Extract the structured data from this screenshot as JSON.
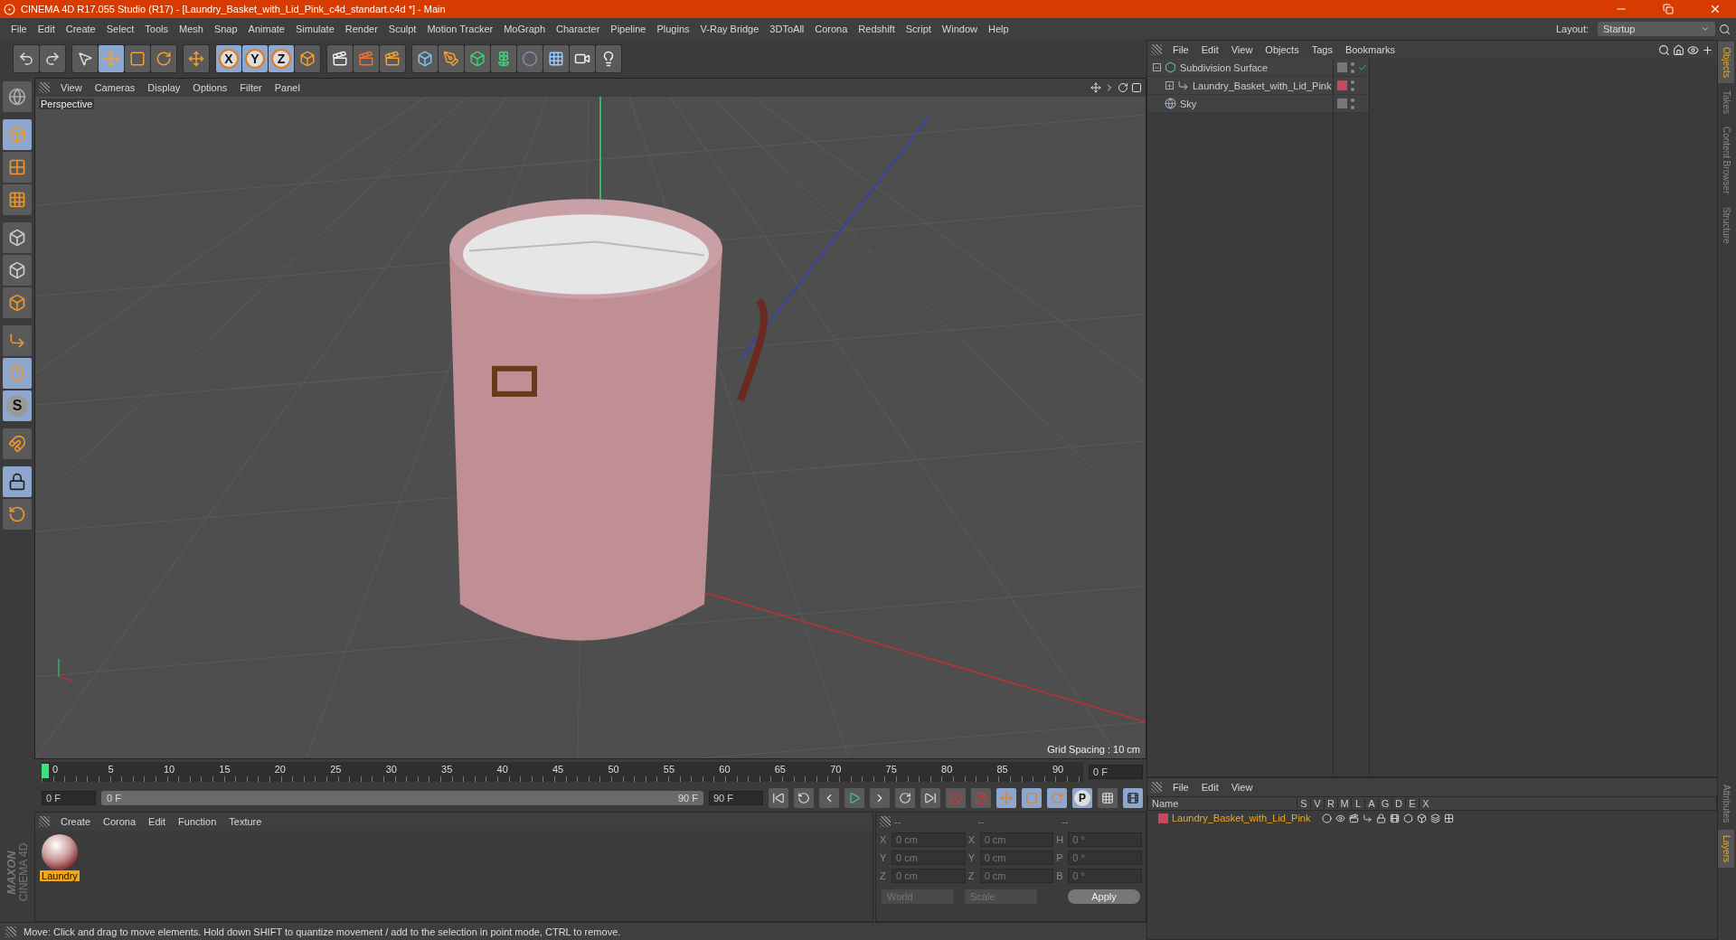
{
  "window": {
    "title": "CINEMA 4D R17.055 Studio (R17) - [Laundry_Basket_with_Lid_Pink_c4d_standart.c4d *] - Main"
  },
  "menu": [
    "File",
    "Edit",
    "Create",
    "Select",
    "Tools",
    "Mesh",
    "Snap",
    "Animate",
    "Simulate",
    "Render",
    "Sculpt",
    "Motion Tracker",
    "MoGraph",
    "Character",
    "Pipeline",
    "Plugins",
    "V-Ray Bridge",
    "3DToAll",
    "Corona",
    "Redshift",
    "Script",
    "Window",
    "Help"
  ],
  "layout": {
    "label": "Layout:",
    "value": "Startup"
  },
  "toolbar": {
    "axis_buttons": [
      "X",
      "Y",
      "Z"
    ]
  },
  "left_tools": {
    "snap_label": "S"
  },
  "viewport": {
    "menu": [
      "View",
      "Cameras",
      "Display",
      "Options",
      "Filter",
      "Panel"
    ],
    "camera": "Perspective",
    "grid_spacing": "Grid Spacing : 10 cm"
  },
  "objects_panel": {
    "menu": [
      "File",
      "Edit",
      "View",
      "Objects",
      "Tags",
      "Bookmarks"
    ],
    "items": [
      {
        "name": "Subdivision Surface",
        "expanded": true,
        "checked": true,
        "children": [
          {
            "name": "Laundry_Basket_with_Lid_Pink",
            "expanded": false,
            "checked": false,
            "color": "#c4485f"
          }
        ]
      },
      {
        "name": "Sky",
        "checked": false
      }
    ]
  },
  "side_tabs_top": [
    {
      "label": "Objects",
      "selected": true
    },
    {
      "label": "Takes",
      "selected": false
    },
    {
      "label": "Content Browser",
      "selected": false
    },
    {
      "label": "Structure",
      "selected": false
    }
  ],
  "side_tabs_bottom": [
    {
      "label": "Attributes",
      "selected": false
    },
    {
      "label": "Layers",
      "selected": true
    }
  ],
  "timeline": {
    "ticks": [
      "0",
      "5",
      "10",
      "15",
      "20",
      "25",
      "30",
      "35",
      "40",
      "45",
      "50",
      "55",
      "60",
      "65",
      "70",
      "75",
      "80",
      "85",
      "90"
    ],
    "level": 0,
    "current_frame": "0 F",
    "start_field": "0 F",
    "range_start": "0 F",
    "range_end": "90 F",
    "end_field": "90 F",
    "keyframe_label": "P"
  },
  "materials": {
    "menu": [
      "Create",
      "Corona",
      "Edit",
      "Function",
      "Texture"
    ],
    "items": [
      {
        "name": "Laundry",
        "selected": true
      }
    ]
  },
  "coordinates": {
    "headers": [
      "--",
      "--",
      "--"
    ],
    "rows": [
      {
        "axis": "X",
        "position": "0 cm",
        "size_axis": "X",
        "size": "0 cm",
        "rot_axis": "H",
        "rotation": "0 °"
      },
      {
        "axis": "Y",
        "position": "0 cm",
        "size_axis": "Y",
        "size": "0 cm",
        "rot_axis": "P",
        "rotation": "0 °"
      },
      {
        "axis": "Z",
        "position": "0 cm",
        "size_axis": "Z",
        "size": "0 cm",
        "rot_axis": "B",
        "rotation": "0 °"
      }
    ],
    "space": "World",
    "mode": "Scale",
    "apply": "Apply"
  },
  "layers_panel": {
    "menu": [
      "File",
      "Edit",
      "View"
    ],
    "columns": [
      "Name",
      "S",
      "V",
      "R",
      "M",
      "L",
      "A",
      "G",
      "D",
      "E",
      "X"
    ],
    "rows": [
      {
        "name": "Laundry_Basket_with_Lid_Pink",
        "color": "#c4485f"
      }
    ]
  },
  "brand": {
    "line1": "MAXON",
    "line2": "CINEMA 4D"
  },
  "status_bar": "Move: Click and drag to move elements. Hold down SHIFT to quantize movement / add to the selection in point mode, CTRL to remove."
}
